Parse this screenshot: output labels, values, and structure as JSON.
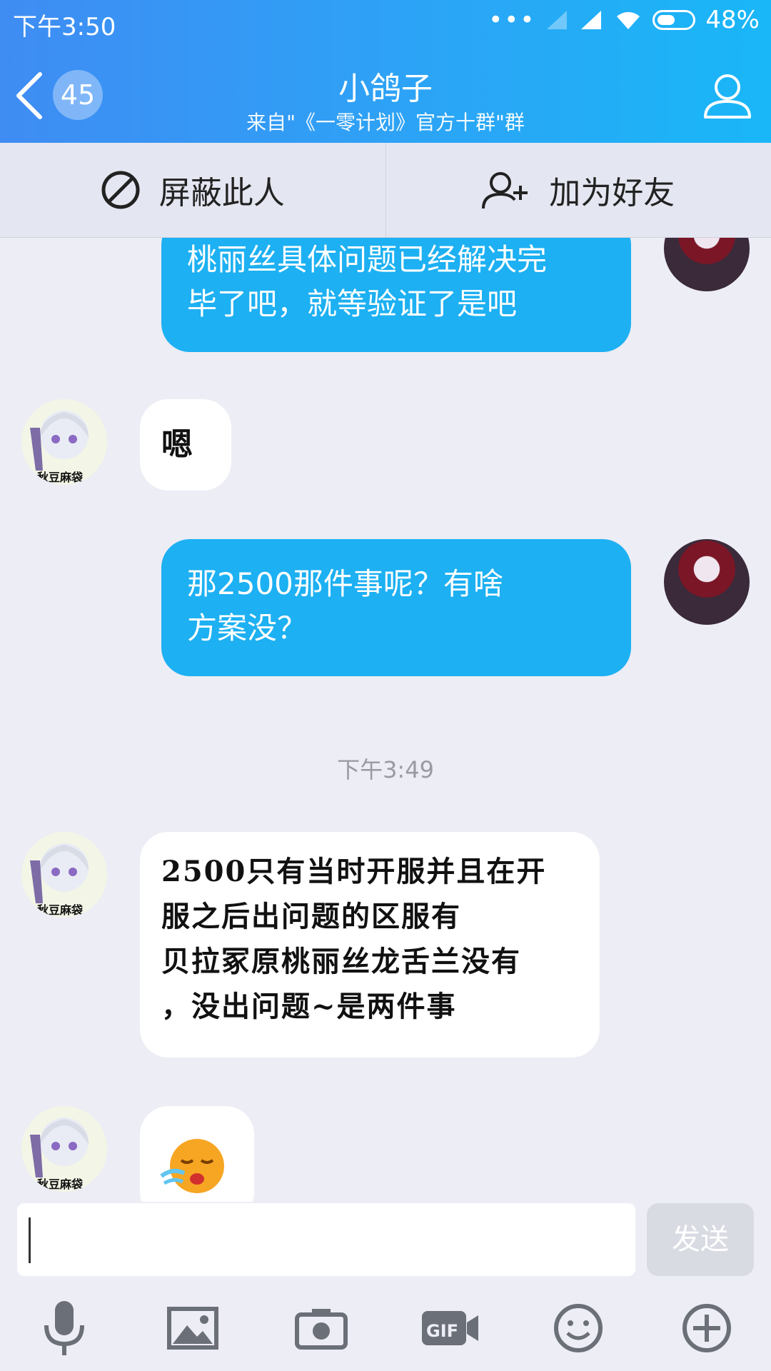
{
  "status_bar": {
    "time": "下午3:50",
    "battery": "48%"
  },
  "header": {
    "unread_count": "45",
    "title": "小鸽子",
    "subtitle": "来自\"《一零计划》官方十群\"群"
  },
  "actions": {
    "block": "屏蔽此人",
    "add_friend": "加为好友"
  },
  "messages": [
    {
      "from": "me",
      "text_line1": "桃丽丝具体问题已经解决完",
      "text_line2": "毕了吧，就等验证了是吧"
    },
    {
      "from": "other",
      "text": "嗯"
    },
    {
      "from": "me",
      "text_line1": "那2500那件事呢？有啥",
      "text_line2": "方案没？"
    },
    {
      "from": "other",
      "line1": "2500只有当时开服并且在开",
      "line2": "服之后出问题的区服有",
      "line3": "贝拉冢原桃丽丝龙舌兰没有",
      "line4": "，没出问题~是两件事"
    },
    {
      "from": "other",
      "emoji": "crying-face"
    }
  ],
  "avatar_caption": "秋豆麻袋",
  "timestamp": "下午3:49",
  "input": {
    "placeholder": "",
    "send_label": "发送"
  },
  "colors": {
    "header_start": "#3f8cf3",
    "header_end": "#19b7f7",
    "my_bubble": "#1db0f2",
    "other_bubble": "#ffffff"
  }
}
